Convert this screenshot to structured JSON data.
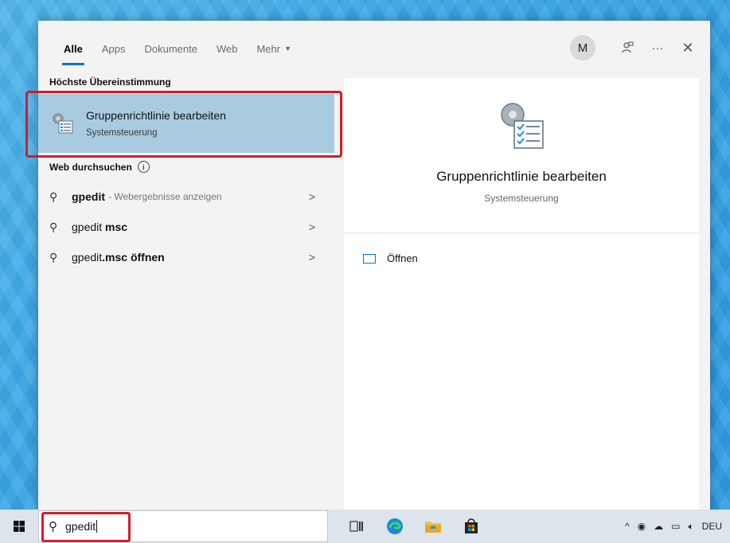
{
  "tabs": [
    {
      "label": "Alle"
    },
    {
      "label": "Apps"
    },
    {
      "label": "Dokumente"
    },
    {
      "label": "Web"
    },
    {
      "label": "Mehr"
    }
  ],
  "user": {
    "initial": "M"
  },
  "best_match": {
    "heading": "Höchste Übereinstimmung",
    "title": "Gruppenrichtlinie bearbeiten",
    "subtitle": "Systemsteuerung"
  },
  "web_search": {
    "heading": "Web durchsuchen",
    "items": [
      {
        "query": "gpedit",
        "hint": " - Webergebnisse anzeigen",
        "suffix": ""
      },
      {
        "query": "gpedit",
        "hint": "",
        "suffix": " msc"
      },
      {
        "query": "gpedit",
        "hint": "",
        "suffix": ".msc öffnen"
      }
    ]
  },
  "preview": {
    "title": "Gruppenrichtlinie bearbeiten",
    "subtitle": "Systemsteuerung",
    "action_open": "Öffnen"
  },
  "taskbar": {
    "search_value": "gpedit",
    "language": "DEU"
  },
  "colors": {
    "accent": "#0078d4",
    "highlight_border": "#d51b2c",
    "selected_bg": "#a9cbe0"
  }
}
